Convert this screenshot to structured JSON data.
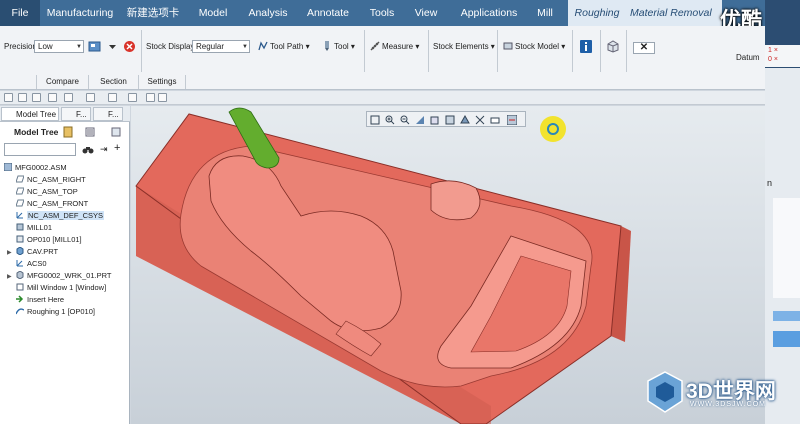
{
  "tabs": [
    "File",
    "Manufacturing",
    "新建选项卡",
    "Model",
    "Analysis",
    "Annotate",
    "Tools",
    "View",
    "Applications",
    "Mill",
    "Roughing",
    "Material Removal"
  ],
  "watermark_top": "优酷",
  "ribbon": {
    "precision_label": "Precision",
    "precision_value": "Low",
    "stock_display_label": "Stock Display",
    "stock_display_value": "Regular",
    "tool_path": "Tool Path",
    "tool": "Tool",
    "measure": "Measure",
    "stock_elements": "Stock Elements",
    "stock_model": "Stock Model",
    "datum": "Datum",
    "group_tabs": [
      "Compare",
      "Section",
      "Settings"
    ]
  },
  "panel": {
    "tab_model_tree": "Model Tree",
    "tab_folder": "F...",
    "tab_fav": "F...",
    "toolbar_label": "Model Tree",
    "search_placeholder": ""
  },
  "tree": [
    "MFG0002.ASM",
    "NC_ASM_RIGHT",
    "NC_ASM_TOP",
    "NC_ASM_FRONT",
    "NC_ASM_DEF_CSYS",
    "MILL01",
    "OP010 [MILL01]",
    "CAV.PRT",
    "ACS0",
    "MFG0002_WRK_01.PRT",
    "Mill Window 1 [Window]",
    "Insert Here",
    "Roughing 1 [OP010]"
  ],
  "side": {
    "numbers": [
      "1 ×",
      "0 ×"
    ],
    "letter": "n"
  },
  "watermark": {
    "name": "3D世界网",
    "url": "WWW.3DSJW.COM"
  },
  "colors": {
    "ribbon_tabs": "#3f6d98",
    "part": "#e8786c",
    "tool": "#5aa62a",
    "highlight": "#cfe3f7"
  }
}
